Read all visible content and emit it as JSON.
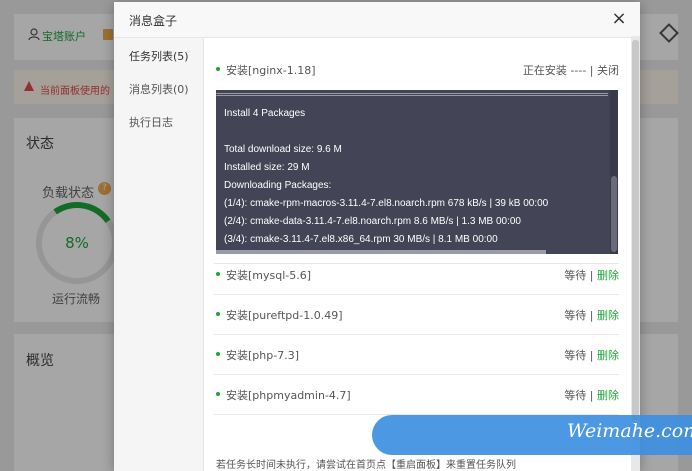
{
  "background": {
    "user_label": "宝塔账户",
    "alert_text": "当前面板使用的",
    "status_title": "状态",
    "load_label": "负载状态",
    "load_value": "8%",
    "running_label": "运行流畅",
    "overview_title": "概览"
  },
  "modal": {
    "title": "消息盒子",
    "close_glyph": "×"
  },
  "sidebar": {
    "items": [
      {
        "label": "任务列表(5)",
        "active": true
      },
      {
        "label": "消息列表(0)",
        "active": false
      },
      {
        "label": "执行日志",
        "active": false
      }
    ]
  },
  "tasks": [
    {
      "name": "安装[nginx-1.18]",
      "state": "正在安装 ----",
      "action": "关闭"
    },
    {
      "name": "安装[mysql-5.6]",
      "state": "等待",
      "action": "删除"
    },
    {
      "name": "安装[pureftpd-1.0.49]",
      "state": "等待",
      "action": "删除"
    },
    {
      "name": "安装[php-7.3]",
      "state": "等待",
      "action": "删除"
    },
    {
      "name": "安装[phpmyadmin-4.7]",
      "state": "等待",
      "action": "删除"
    }
  ],
  "status_separator": "|",
  "console": {
    "rule": "================================================================================================================================================",
    "lines": [
      "Install 4 Packages",
      "",
      "Total download size: 9.6 M",
      "Installed size: 29 M",
      "Downloading Packages:",
      "(1/4): cmake-rpm-macros-3.11.4-7.el8.noarch.rpm 678 kB/s | 39 kB 00:00",
      "(2/4): cmake-data-3.11.4-7.el8.noarch.rpm 8.6 MB/s | 1.3 MB 00:00",
      "(3/4): cmake-3.11.4-7.el8.x86_64.rpm 30 MB/s | 8.1 MB 00:00"
    ]
  },
  "footer_note": "若任务长时间未执行，请尝试在首页点【重启面板】来重置任务队列",
  "watermark": "Weimahe.com",
  "colors": {
    "accent_green": "#20a53a",
    "console_bg": "#434455",
    "watermark_blue": "#3d8fe0"
  }
}
